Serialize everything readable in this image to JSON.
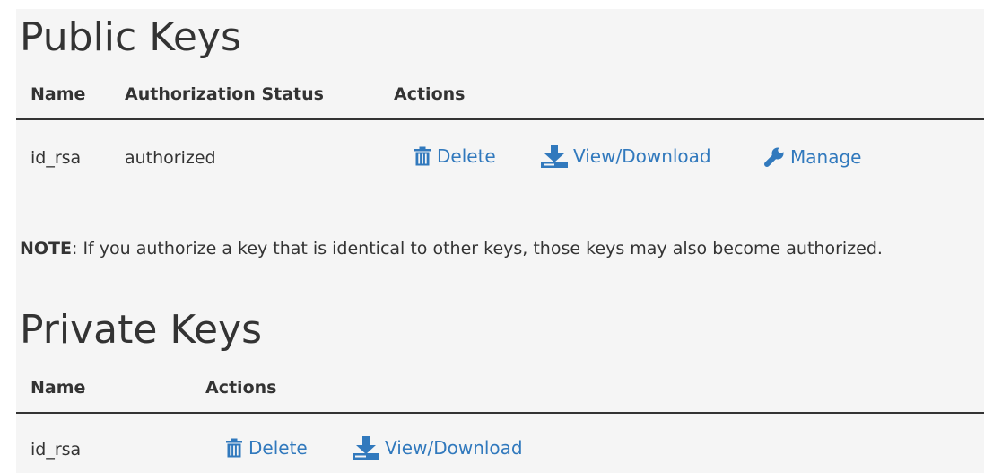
{
  "public_keys": {
    "title": "Public Keys",
    "columns": [
      "Name",
      "Authorization Status",
      "Actions"
    ],
    "rows": [
      {
        "name": "id_rsa",
        "status": "authorized",
        "actions": {
          "delete": "Delete",
          "view_download": "View/Download",
          "manage": "Manage"
        }
      }
    ]
  },
  "note": {
    "label": "NOTE",
    "text": ": If you authorize a key that is identical to other keys, those keys may also become authorized."
  },
  "private_keys": {
    "title": "Private Keys",
    "columns": [
      "Name",
      "Actions"
    ],
    "rows": [
      {
        "name": "id_rsa",
        "actions": {
          "delete": "Delete",
          "view_download": "View/Download"
        }
      }
    ]
  },
  "colors": {
    "link": "#3179bd",
    "text": "#333333",
    "background": "#f5f5f5"
  },
  "icons": [
    "trash-icon",
    "download-icon",
    "wrench-icon"
  ]
}
